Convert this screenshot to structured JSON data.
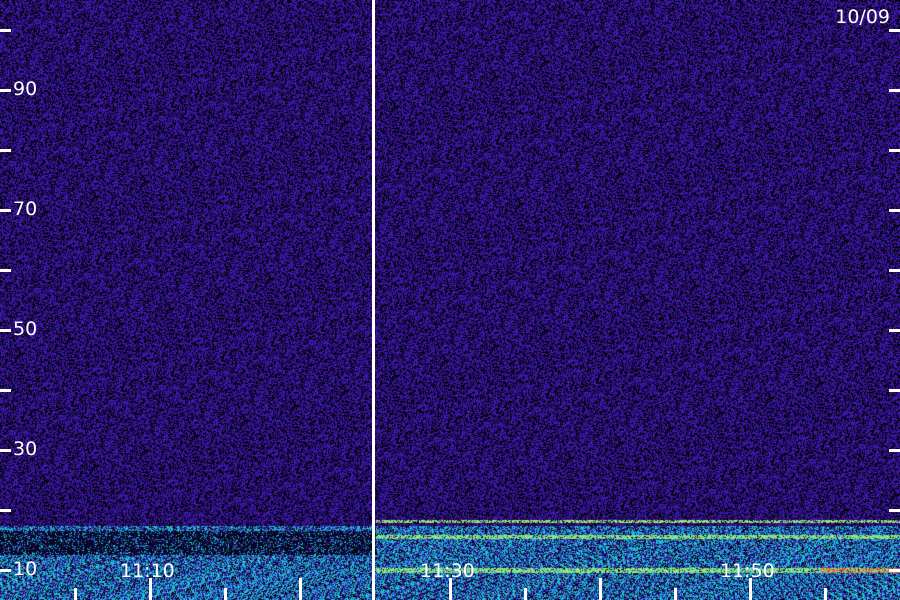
{
  "date_label": "10/09",
  "y_axis": {
    "labels": [
      "90",
      "70",
      "50",
      "30",
      "10"
    ]
  },
  "x_axis": {
    "labels": [
      "11:10",
      "11:30",
      "11:50"
    ]
  },
  "colors": {
    "background_noise": "#3a1aa0",
    "low_band": "#29c7e0",
    "hot_band": "#ffe04a",
    "text": "#ffffff"
  }
}
